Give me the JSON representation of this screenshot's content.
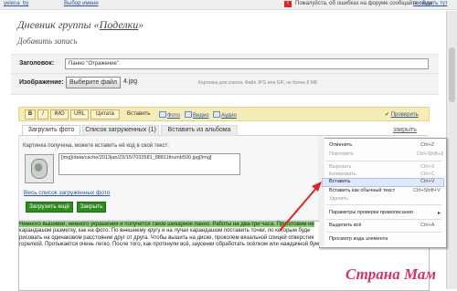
{
  "topbar": {
    "user_link": "yelena_by",
    "region_link": "Выбор имени",
    "feedback_text": "Пожалуйста, об ошибках на форуме сообщайте сюда",
    "feedback_link": "сообщить тут",
    "flag_label": "!"
  },
  "page": {
    "title_prefix": "Дневник группы «",
    "title_link": "Поделки",
    "title_suffix": "»",
    "subtitle": "Добавить запись"
  },
  "form": {
    "title_label": "Заголовок:",
    "title_value": "Панно \"Отражение\".",
    "image_label": "Изображение:",
    "file_button": "Выберите файл",
    "file_name": "4.jpg",
    "file_hint": "Картинка для списка. Файл JPG или GIF, не более 8 МБ"
  },
  "toolbar": {
    "bold": "B",
    "italic": "I",
    "img": "IMG",
    "url": "URL",
    "quote": "Цитата",
    "insert": "Вставить",
    "photo": "Фото",
    "video": "Видео",
    "audio": "Аудио",
    "check": "Проверить"
  },
  "tabs": {
    "items": [
      {
        "label": "Загрузить фото"
      },
      {
        "label": "Список загруженных (1)"
      },
      {
        "label": "Вставить из альбома"
      }
    ],
    "close": "закрыть"
  },
  "upload": {
    "message": "Картинка получена, можете вставить её код в свой текст:",
    "code": "[img]/data/cache/2013jan/23/15/7032581_88811thumb500.jpg[/img]",
    "all_link": "Весь список загруженных фото",
    "upload_more": "Загрузить ещё",
    "close_button": "Закрыть"
  },
  "editor": {
    "lines": [
      "Немного вышивки, немного украшения и получится такое шикарное панно. Работы на два-три часа. Приготовим не",
      "карандашом разметку, как на фото. По внешнему кругу и на лучах карандашом поставить точки, по которым буде",
      "рисовать на одинаковом расстоянии друг от друга. Чтобы вышить на диске, проколем вязальной спицей отверстия",
      "горелкой. Протыкается очень легко. После того, как проткнули всё, заусенки обработать осёлком или наждачной бумагой."
    ]
  },
  "context_menu": {
    "items": [
      {
        "label": "Отменить",
        "shortcut": "Ctrl+Z",
        "enabled": true
      },
      {
        "label": "Повторить",
        "shortcut": "Ctrl+Shift+Z",
        "enabled": false
      },
      {
        "label": "Вырезать",
        "shortcut": "Ctrl+X",
        "enabled": false
      },
      {
        "label": "Копировать",
        "shortcut": "Ctrl+C",
        "enabled": false
      },
      {
        "label": "Вставить",
        "shortcut": "Ctrl+V",
        "enabled": true
      },
      {
        "label": "Вставить как обычный текст",
        "shortcut": "Ctrl+Shift+V",
        "enabled": true
      },
      {
        "label": "Удалить",
        "shortcut": "",
        "enabled": false
      },
      {
        "label": "Параметры проверки правописания",
        "shortcut": "",
        "enabled": true
      },
      {
        "label": "Выделить всё",
        "shortcut": "Ctrl+A",
        "enabled": true
      },
      {
        "label": "Просмотр кода элемента",
        "shortcut": "",
        "enabled": true
      }
    ]
  },
  "watermark": "Страна Мам",
  "colors": {
    "accent_green": "#2f8b1e",
    "toolbar_yellow": "#f6ecb8",
    "arrow_red": "#d8262a",
    "watermark_pink": "#d0346c"
  }
}
